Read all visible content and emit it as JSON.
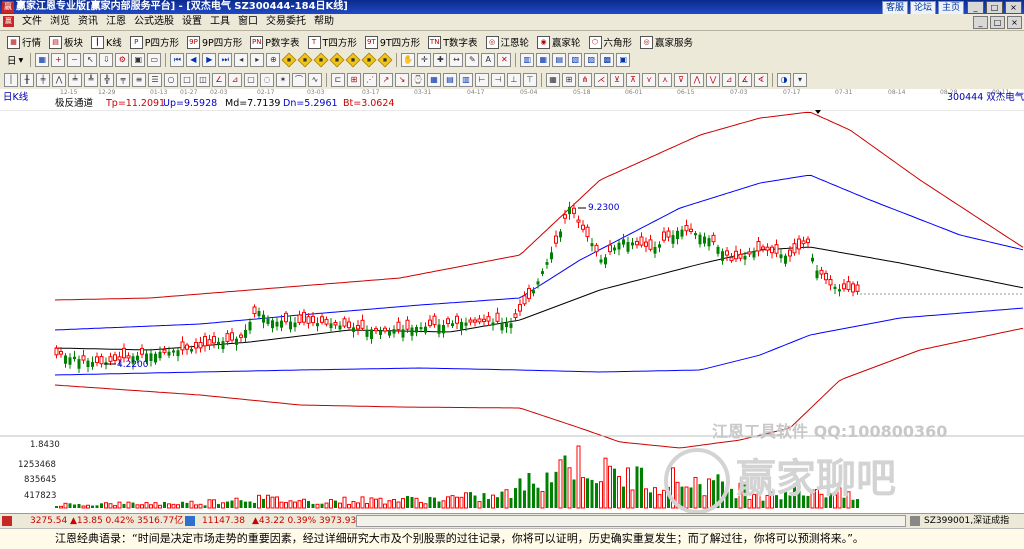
{
  "app": {
    "title": "赢家江恩专业版[赢家内部服务平台] - [双杰电气  SZ300444-184日K线]",
    "title_links": [
      "客服",
      "论坛",
      "主页"
    ],
    "window_buttons": [
      "_",
      "□",
      "×"
    ]
  },
  "menu": [
    "文件",
    "浏览",
    "资讯",
    "江恩",
    "公式选股",
    "设置",
    "工具",
    "窗口",
    "交易委托",
    "帮助"
  ],
  "toolbar1": [
    {
      "label": "行情",
      "icon": "grid-icon"
    },
    {
      "label": "板块",
      "icon": "sector-icon"
    },
    {
      "label": "K线",
      "icon": "kline-icon"
    },
    {
      "label": "P四方形",
      "icon": "P-icon"
    },
    {
      "label": "9P四方形",
      "icon": "9P-icon"
    },
    {
      "label": "P数字表",
      "icon": "PN-icon"
    },
    {
      "label": "T四方形",
      "icon": "T-icon"
    },
    {
      "label": "9T四方形",
      "icon": "9T-icon"
    },
    {
      "label": "T数字表",
      "icon": "TN-icon"
    },
    {
      "label": "江恩轮",
      "icon": "gann-wheel-icon"
    },
    {
      "label": "赢家轮",
      "icon": "winner-wheel-icon"
    },
    {
      "label": "六角形",
      "icon": "hexagon-icon"
    },
    {
      "label": "赢家服务",
      "icon": "service-icon"
    }
  ],
  "toolbar2_left": [
    "日",
    "▾"
  ],
  "date_ticks": [
    "12-15",
    "12-29",
    "01-13",
    "01-27",
    "02-03",
    "02-17",
    "03-03",
    "03-17",
    "03-31",
    "04-17",
    "05-04",
    "05-18",
    "06-01",
    "06-15",
    "07-03",
    "07-17",
    "07-31",
    "08-14",
    "08-28",
    "09-11"
  ],
  "info": {
    "period": "日K线",
    "indicator": "极反通道",
    "tp": "Tp=11.2091",
    "up": "Up=9.5928",
    "md": "Md=7.7139",
    "dn": "Dn=5.2961",
    "bt": "Bt=3.0624",
    "stock": "300444 双杰电气"
  },
  "annotations": {
    "high": "9.2300",
    "low": "4.2200"
  },
  "volume_axis": [
    "1.8430",
    "1253468",
    "835645",
    "417823"
  ],
  "watermark": {
    "line1": "江恩工具软件  QQ:100800360",
    "line2": "赢家聊吧"
  },
  "colors": {
    "up": "#ff0000",
    "down": "#008000",
    "mid": "#000000",
    "inner": "#0000ff",
    "outer": "#cc0000"
  },
  "status": {
    "sh": "3275.54",
    "sh_chg": "▲13.85 0.42% 3516.77亿",
    "sz": "11147.38",
    "sz_chg": "▲43.22 0.39% 3973.93",
    "right": "SZ399001,深证成指"
  },
  "quote": "江恩经典语录：“时间是决定市场走势的重要因素，经过详细研究大市及个别股票的过往记录，你将可以证明，历史确实重复发生；而了解过往，你将可以预测将来。”。"
}
